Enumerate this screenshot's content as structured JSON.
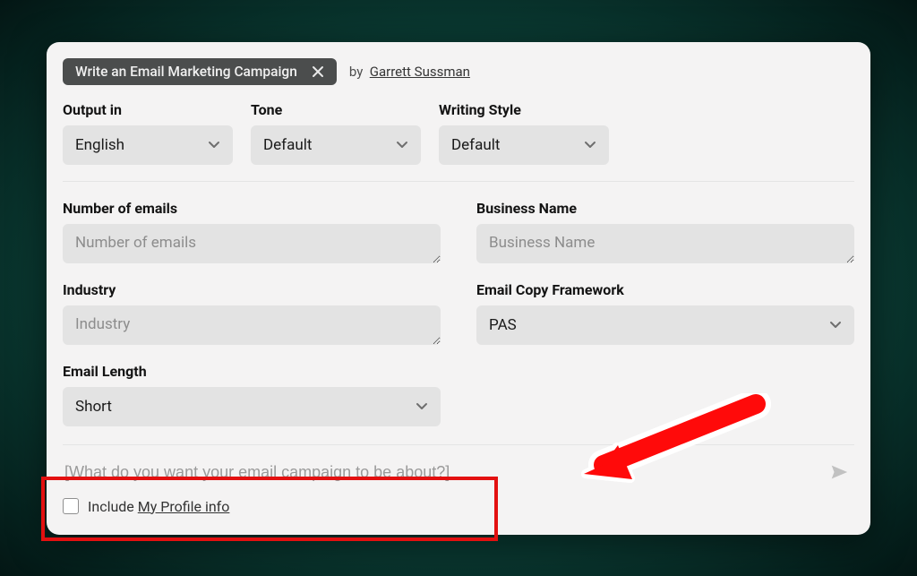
{
  "header": {
    "chip_label": "Write an Email Marketing Campaign",
    "by_prefix": "by",
    "author": "Garrett Sussman"
  },
  "top_fields": {
    "output_in": {
      "label": "Output in",
      "value": "English"
    },
    "tone": {
      "label": "Tone",
      "value": "Default"
    },
    "writing_style": {
      "label": "Writing Style",
      "value": "Default"
    }
  },
  "form": {
    "number_of_emails": {
      "label": "Number of emails",
      "placeholder": "Number of emails"
    },
    "business_name": {
      "label": "Business Name",
      "placeholder": "Business Name"
    },
    "industry": {
      "label": "Industry",
      "placeholder": "Industry"
    },
    "email_framework": {
      "label": "Email Copy Framework",
      "value": "PAS"
    },
    "email_length": {
      "label": "Email Length",
      "value": "Short"
    }
  },
  "prompt": {
    "placeholder": "[What do you want your email campaign to be about?]"
  },
  "profile": {
    "prefix": "Include",
    "link": "My Profile info"
  },
  "annotation": {
    "arrow_color": "#ff0000"
  }
}
